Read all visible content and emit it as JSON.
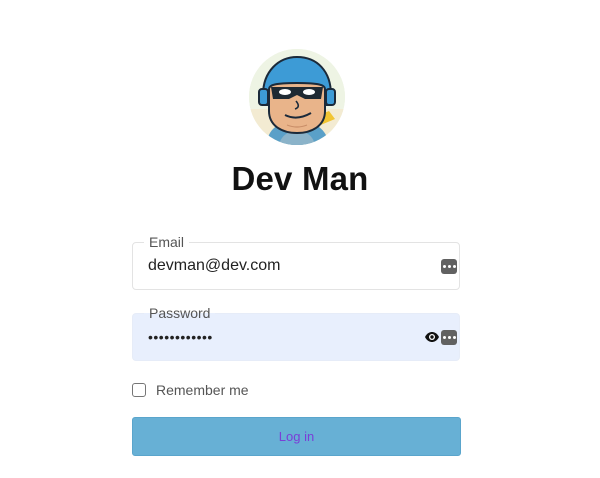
{
  "profile": {
    "name": "Dev Man",
    "avatar_icon": "superhero-avatar"
  },
  "form": {
    "email": {
      "label": "Email",
      "value": "devman@dev.com"
    },
    "password": {
      "label": "Password",
      "value": "••••••••••••"
    },
    "remember": {
      "label": "Remember me",
      "checked": false
    },
    "login_button": {
      "label": "Log in"
    }
  },
  "colors": {
    "button_bg": "#67b0d5",
    "button_text": "#7a3fd6",
    "autofill_bg": "#e8effd"
  },
  "icons": {
    "password_manager": "password-manager-icon",
    "reveal_password": "eye-icon"
  }
}
